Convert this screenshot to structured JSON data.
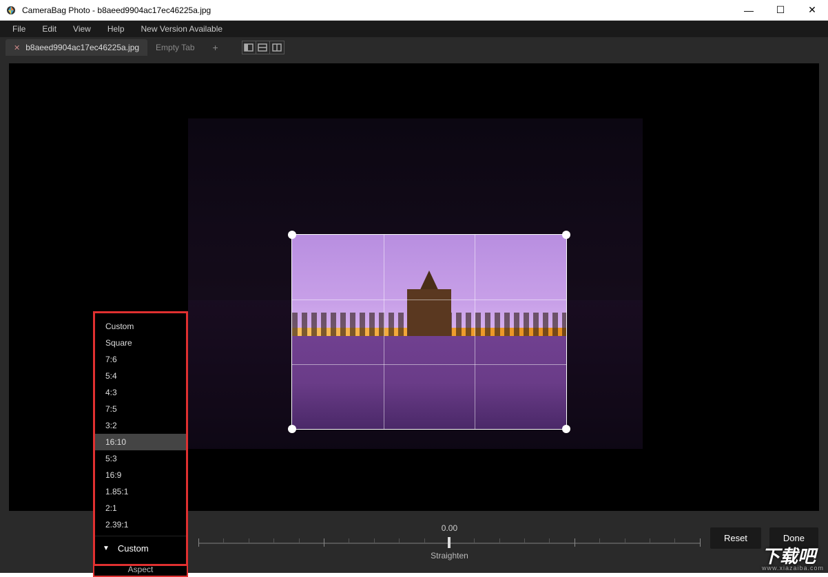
{
  "titlebar": {
    "app_name": "CameraBag Photo",
    "document": "b8aeed9904ac17ec46225a.jpg",
    "full_title": "CameraBag Photo - b8aeed9904ac17ec46225a.jpg"
  },
  "window_controls": {
    "minimize": "—",
    "maximize": "☐",
    "close": "✕"
  },
  "menubar": {
    "items": [
      "File",
      "Edit",
      "View",
      "Help",
      "New Version Available"
    ]
  },
  "tabs": {
    "active": {
      "label": "b8aeed9904ac17ec46225a.jpg",
      "close": "✕"
    },
    "inactive": {
      "label": "Empty Tab"
    },
    "add": "+"
  },
  "aspect_menu": {
    "options": [
      "Custom",
      "Square",
      "7:6",
      "5:4",
      "4:3",
      "7:5",
      "3:2",
      "16:10",
      "5:3",
      "16:9",
      "1.85:1",
      "2:1",
      "2.39:1"
    ],
    "selected_index": 7,
    "current": "Custom",
    "section_label": "Aspect"
  },
  "straighten": {
    "value": "0.00",
    "label": "Straighten"
  },
  "buttons": {
    "reset": "Reset",
    "done": "Done"
  },
  "watermark": {
    "main": "下载吧",
    "sub": "www.xiazaiba.com"
  }
}
